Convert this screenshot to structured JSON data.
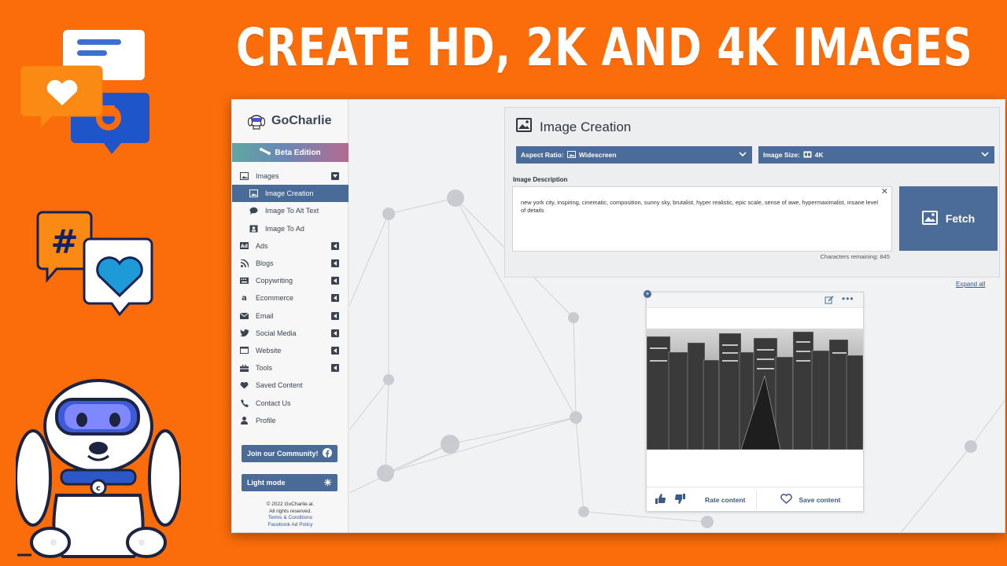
{
  "headline": "CREATE HD, 2K AND 4K IMAGES",
  "app": {
    "brand": "GoCharlie",
    "beta_label": "Beta Edition",
    "nav": [
      {
        "label": "Images",
        "icon": "image-icon",
        "toggle": "down"
      },
      {
        "label": "Image Creation",
        "icon": "image-icon",
        "sub": true,
        "active": true
      },
      {
        "label": "Image To Alt Text",
        "icon": "chat-icon",
        "sub": true
      },
      {
        "label": "Image To Ad",
        "icon": "portrait-icon",
        "sub": true
      },
      {
        "label": "Ads",
        "icon": "ad-icon",
        "toggle": "left"
      },
      {
        "label": "Blogs",
        "icon": "rss-icon",
        "toggle": "left"
      },
      {
        "label": "Copywriting",
        "icon": "keyboard-icon",
        "toggle": "left"
      },
      {
        "label": "Ecommerce",
        "icon": "amazon-icon",
        "toggle": "left"
      },
      {
        "label": "Email",
        "icon": "envelope-icon",
        "toggle": "left"
      },
      {
        "label": "Social Media",
        "icon": "twitter-icon",
        "toggle": "left"
      },
      {
        "label": "Website",
        "icon": "browser-icon",
        "toggle": "left"
      },
      {
        "label": "Tools",
        "icon": "toolbox-icon",
        "toggle": "left"
      },
      {
        "label": "Saved Content",
        "icon": "heart-icon"
      },
      {
        "label": "Contact Us",
        "icon": "phone-icon"
      },
      {
        "label": "Profile",
        "icon": "user-icon"
      }
    ],
    "community_button": "Join our Community!",
    "light_mode_button": "Light mode",
    "footer": {
      "copyright": "© 2022 GoCharlie.ai.",
      "rights": "All rights reserved.",
      "terms": "Terms & Conditions",
      "policy": "Facebook Ad Policy"
    }
  },
  "image_creation": {
    "title": "Image Creation",
    "aspect_ratio_label": "Aspect Ratio:",
    "aspect_ratio_value": "Widescreen",
    "image_size_label": "Image Size:",
    "image_size_value": "4K",
    "description_label": "Image Description",
    "description_text": "new york city, inspiring, cinematic, composition, sunny sky, brutalist, hyper realistic, epic scale, sense of awe, hypermaximalist, insane level of details",
    "chars_remaining": "Characters remaining: 845",
    "fetch_button": "Fetch",
    "expand_all": "Expand all"
  },
  "result": {
    "rate_label": "Rate content",
    "save_label": "Save content"
  },
  "colors": {
    "background": "#fb6d0a",
    "accent": "#4b6b98",
    "link": "#2f56a5"
  }
}
